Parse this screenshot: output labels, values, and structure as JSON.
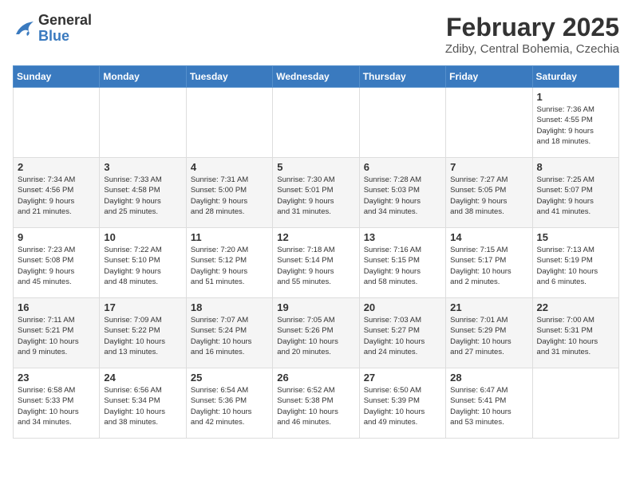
{
  "logo": {
    "general": "General",
    "blue": "Blue"
  },
  "title": "February 2025",
  "subtitle": "Zdiby, Central Bohemia, Czechia",
  "days_of_week": [
    "Sunday",
    "Monday",
    "Tuesday",
    "Wednesday",
    "Thursday",
    "Friday",
    "Saturday"
  ],
  "weeks": [
    [
      {
        "day": "",
        "info": ""
      },
      {
        "day": "",
        "info": ""
      },
      {
        "day": "",
        "info": ""
      },
      {
        "day": "",
        "info": ""
      },
      {
        "day": "",
        "info": ""
      },
      {
        "day": "",
        "info": ""
      },
      {
        "day": "1",
        "info": "Sunrise: 7:36 AM\nSunset: 4:55 PM\nDaylight: 9 hours\nand 18 minutes."
      }
    ],
    [
      {
        "day": "2",
        "info": "Sunrise: 7:34 AM\nSunset: 4:56 PM\nDaylight: 9 hours\nand 21 minutes."
      },
      {
        "day": "3",
        "info": "Sunrise: 7:33 AM\nSunset: 4:58 PM\nDaylight: 9 hours\nand 25 minutes."
      },
      {
        "day": "4",
        "info": "Sunrise: 7:31 AM\nSunset: 5:00 PM\nDaylight: 9 hours\nand 28 minutes."
      },
      {
        "day": "5",
        "info": "Sunrise: 7:30 AM\nSunset: 5:01 PM\nDaylight: 9 hours\nand 31 minutes."
      },
      {
        "day": "6",
        "info": "Sunrise: 7:28 AM\nSunset: 5:03 PM\nDaylight: 9 hours\nand 34 minutes."
      },
      {
        "day": "7",
        "info": "Sunrise: 7:27 AM\nSunset: 5:05 PM\nDaylight: 9 hours\nand 38 minutes."
      },
      {
        "day": "8",
        "info": "Sunrise: 7:25 AM\nSunset: 5:07 PM\nDaylight: 9 hours\nand 41 minutes."
      }
    ],
    [
      {
        "day": "9",
        "info": "Sunrise: 7:23 AM\nSunset: 5:08 PM\nDaylight: 9 hours\nand 45 minutes."
      },
      {
        "day": "10",
        "info": "Sunrise: 7:22 AM\nSunset: 5:10 PM\nDaylight: 9 hours\nand 48 minutes."
      },
      {
        "day": "11",
        "info": "Sunrise: 7:20 AM\nSunset: 5:12 PM\nDaylight: 9 hours\nand 51 minutes."
      },
      {
        "day": "12",
        "info": "Sunrise: 7:18 AM\nSunset: 5:14 PM\nDaylight: 9 hours\nand 55 minutes."
      },
      {
        "day": "13",
        "info": "Sunrise: 7:16 AM\nSunset: 5:15 PM\nDaylight: 9 hours\nand 58 minutes."
      },
      {
        "day": "14",
        "info": "Sunrise: 7:15 AM\nSunset: 5:17 PM\nDaylight: 10 hours\nand 2 minutes."
      },
      {
        "day": "15",
        "info": "Sunrise: 7:13 AM\nSunset: 5:19 PM\nDaylight: 10 hours\nand 6 minutes."
      }
    ],
    [
      {
        "day": "16",
        "info": "Sunrise: 7:11 AM\nSunset: 5:21 PM\nDaylight: 10 hours\nand 9 minutes."
      },
      {
        "day": "17",
        "info": "Sunrise: 7:09 AM\nSunset: 5:22 PM\nDaylight: 10 hours\nand 13 minutes."
      },
      {
        "day": "18",
        "info": "Sunrise: 7:07 AM\nSunset: 5:24 PM\nDaylight: 10 hours\nand 16 minutes."
      },
      {
        "day": "19",
        "info": "Sunrise: 7:05 AM\nSunset: 5:26 PM\nDaylight: 10 hours\nand 20 minutes."
      },
      {
        "day": "20",
        "info": "Sunrise: 7:03 AM\nSunset: 5:27 PM\nDaylight: 10 hours\nand 24 minutes."
      },
      {
        "day": "21",
        "info": "Sunrise: 7:01 AM\nSunset: 5:29 PM\nDaylight: 10 hours\nand 27 minutes."
      },
      {
        "day": "22",
        "info": "Sunrise: 7:00 AM\nSunset: 5:31 PM\nDaylight: 10 hours\nand 31 minutes."
      }
    ],
    [
      {
        "day": "23",
        "info": "Sunrise: 6:58 AM\nSunset: 5:33 PM\nDaylight: 10 hours\nand 34 minutes."
      },
      {
        "day": "24",
        "info": "Sunrise: 6:56 AM\nSunset: 5:34 PM\nDaylight: 10 hours\nand 38 minutes."
      },
      {
        "day": "25",
        "info": "Sunrise: 6:54 AM\nSunset: 5:36 PM\nDaylight: 10 hours\nand 42 minutes."
      },
      {
        "day": "26",
        "info": "Sunrise: 6:52 AM\nSunset: 5:38 PM\nDaylight: 10 hours\nand 46 minutes."
      },
      {
        "day": "27",
        "info": "Sunrise: 6:50 AM\nSunset: 5:39 PM\nDaylight: 10 hours\nand 49 minutes."
      },
      {
        "day": "28",
        "info": "Sunrise: 6:47 AM\nSunset: 5:41 PM\nDaylight: 10 hours\nand 53 minutes."
      },
      {
        "day": "",
        "info": ""
      }
    ]
  ]
}
